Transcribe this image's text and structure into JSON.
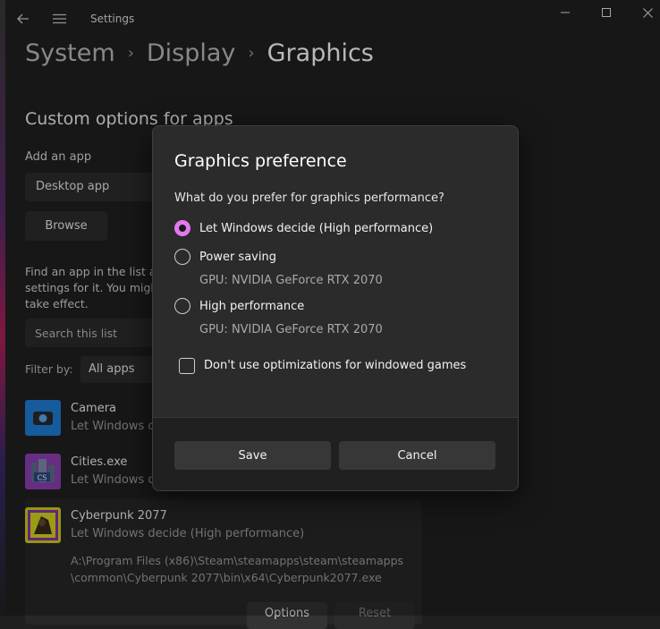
{
  "titlebar": {
    "app_title": "Settings",
    "back_icon": "arrow-left-icon",
    "menu_icon": "hamburger-menu-icon",
    "minimize_icon": "minimize-icon",
    "maximize_icon": "maximize-icon",
    "close_icon": "close-icon"
  },
  "breadcrumb": [
    "System",
    "Display",
    "Graphics"
  ],
  "page": {
    "section_title": "Custom options for apps",
    "add_app_label": "Add an app",
    "app_type_value": "Desktop app",
    "browse_label": "Browse",
    "description": "Find an app in the list a settings for it. You migh take effect.",
    "search_placeholder": "Search this list",
    "filter_label": "Filter by:",
    "filter_value": "All apps"
  },
  "apps": [
    {
      "name": "Camera",
      "status": "Let Windows d",
      "icon": "camera-app-icon",
      "color": "#1f7fd8"
    },
    {
      "name": "Cities.exe",
      "status": "Let Windows d",
      "icon": "cities-skylines-icon",
      "color": "#8f3fb4"
    },
    {
      "name": "Cyberpunk 2077",
      "status": "Let Windows decide (High performance)",
      "icon": "cyberpunk-icon",
      "color": "#cfd11e",
      "path_line1": "A:\\Program Files (x86)\\Steam\\steamapps\\steam\\steamapps",
      "path_line2": "\\common\\Cyberpunk 2077\\bin\\x64\\Cyberpunk2077.exe",
      "options_label": "Options",
      "reset_label": "Reset"
    }
  ],
  "dialog": {
    "title": "Graphics preference",
    "question": "What do you prefer for graphics performance?",
    "options": [
      {
        "label": "Let Windows decide (High performance)",
        "sub": "",
        "selected": true
      },
      {
        "label": "Power saving",
        "sub": "GPU: NVIDIA GeForce RTX 2070",
        "selected": false
      },
      {
        "label": "High performance",
        "sub": "GPU: NVIDIA GeForce RTX 2070",
        "selected": false
      }
    ],
    "checkbox_label": "Don't use optimizations for windowed games",
    "checkbox_checked": false,
    "save_label": "Save",
    "cancel_label": "Cancel"
  },
  "colors": {
    "accent": "#e279f0",
    "background": "#202020",
    "dialog_bg": "#2b2b2b"
  }
}
